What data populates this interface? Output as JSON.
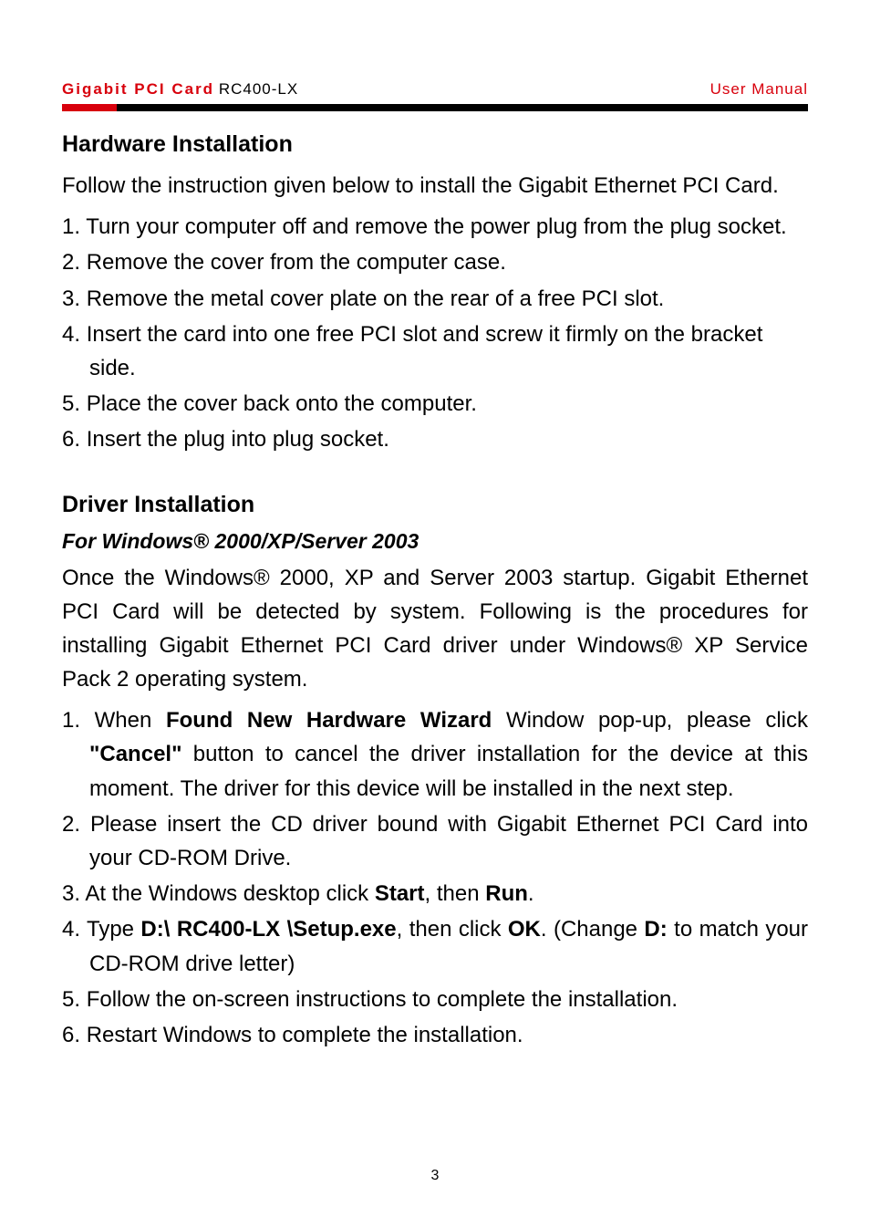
{
  "header": {
    "product_name": "Gigabit PCI Card",
    "model": "RC400-LX",
    "doc_type": "User Manual"
  },
  "section1": {
    "heading": "Hardware Installation",
    "intro": "Follow the instruction given below to install the Gigabit Ethernet PCI Card.",
    "items": [
      {
        "n": "1.",
        "text": "Turn your computer off and remove the power plug from the plug socket."
      },
      {
        "n": "2.",
        "text": "Remove the cover from the computer case."
      },
      {
        "n": "3.",
        "text": "Remove the metal cover plate on the rear of a free PCI slot."
      },
      {
        "n": "4.",
        "text": "Insert the card into one free PCI slot and screw it firmly on the bracket side."
      },
      {
        "n": "5.",
        "text": "Place the cover back onto the computer."
      },
      {
        "n": "6.",
        "text": "Insert the plug into plug socket."
      }
    ]
  },
  "section2": {
    "heading": "Driver Installation",
    "subheading": "For Windows® 2000/XP/Server 2003",
    "intro": "Once the Windows® 2000, XP and Server 2003 startup. Gigabit Ethernet PCI Card will be detected by system. Following is the procedures for installing Gigabit Ethernet PCI Card driver under Windows® XP Service Pack 2 operating system.",
    "item1": {
      "n": "1.",
      "pre": "When ",
      "bold1": "Found New Hardware Wizard",
      "mid1": " Window pop-up, please click ",
      "bold2": "\"Cancel\"",
      "post": " button to cancel the driver installation for the device at this moment. The driver for this device will be installed in the next step."
    },
    "item2": {
      "n": "2.",
      "text": "Please insert the CD driver bound with Gigabit Ethernet PCI Card into your CD-ROM Drive."
    },
    "item3": {
      "n": "3.",
      "pre": "At the Windows desktop click ",
      "bold1": "Start",
      "mid": ", then ",
      "bold2": "Run",
      "post": "."
    },
    "item4": {
      "n": "4.",
      "pre": "Type ",
      "bold1": "D:\\ RC400-LX \\Setup.exe",
      "mid1": ", then click ",
      "bold2": "OK",
      "mid2": ". (Change ",
      "bold3": "D:",
      "post": " to match your CD-ROM drive letter)"
    },
    "item5": {
      "n": "5.",
      "text": "Follow the on-screen instructions to complete the installation."
    },
    "item6": {
      "n": "6.",
      "text": "Restart Windows to complete the installation."
    }
  },
  "page_number": "3"
}
